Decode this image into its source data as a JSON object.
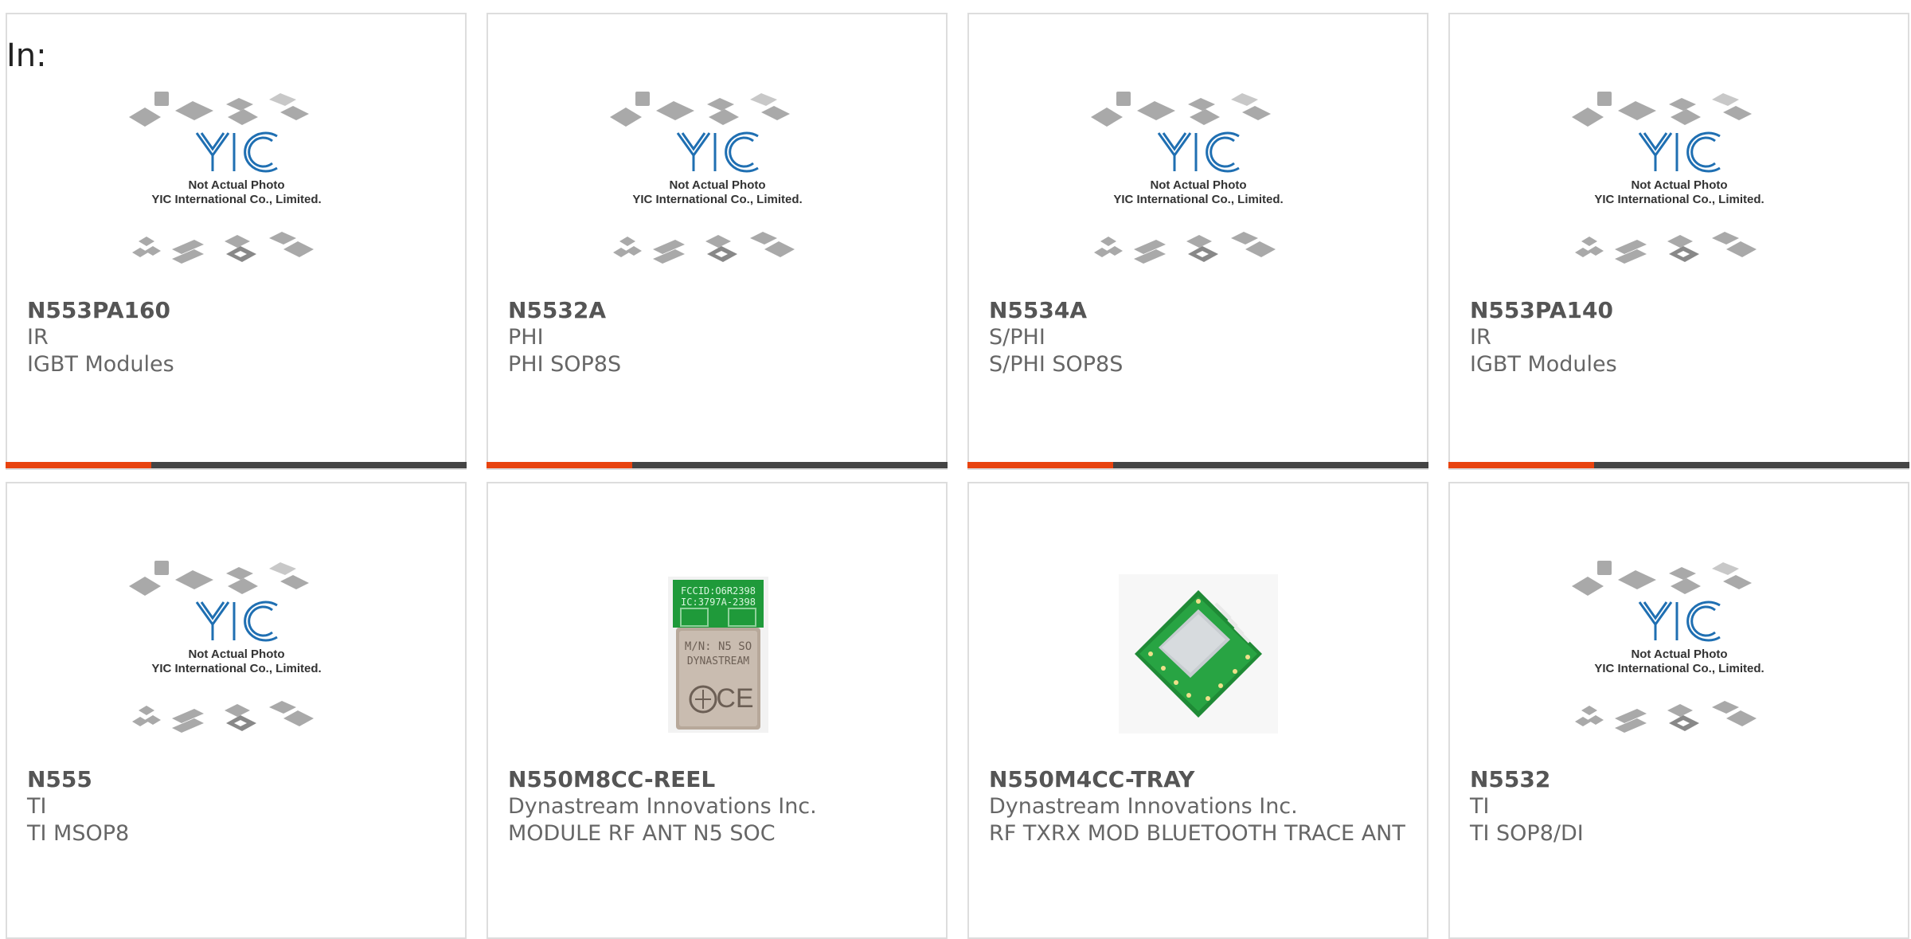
{
  "page": {
    "in_label": "In:"
  },
  "placeholder": {
    "line1": "Not Actual Photo",
    "line2": "YIC International Co., Limited."
  },
  "colors": {
    "accent": "#e8430f",
    "bar": "#444444",
    "logo_blue": "#1f6fb2",
    "pcb_green": "#1f9a3a"
  },
  "cards": [
    {
      "part": "N553PA160",
      "maker": "IR",
      "desc": "IGBT Modules",
      "image": "yic-placeholder"
    },
    {
      "part": "N5532A",
      "maker": "PHI",
      "desc": "PHI SOP8S",
      "image": "yic-placeholder"
    },
    {
      "part": "N5534A",
      "maker": "S/PHI",
      "desc": "S/PHI SOP8S",
      "image": "yic-placeholder"
    },
    {
      "part": "N553PA140",
      "maker": "IR",
      "desc": "IGBT Modules",
      "image": "yic-placeholder"
    },
    {
      "part": "N555",
      "maker": "TI",
      "desc": "TI MSOP8",
      "image": "yic-placeholder"
    },
    {
      "part": "N550M8CC-REEL",
      "maker": "Dynastream Innovations Inc.",
      "desc": "MODULE RF ANT N5 SOC",
      "image": "rf-module-photo",
      "photo_text": [
        "FCCID:O6R2398",
        "IC:3797A-2398",
        "M/N: N5 SO",
        "DYNASTREAM"
      ]
    },
    {
      "part": "N550M4CC-TRAY",
      "maker": "Dynastream Innovations Inc.",
      "desc": "RF TXRX MOD BLUETOOTH TRACE ANT",
      "image": "pcb-module-photo"
    },
    {
      "part": "N5532",
      "maker": "TI",
      "desc": "TI SOP8/DI",
      "image": "yic-placeholder"
    }
  ]
}
